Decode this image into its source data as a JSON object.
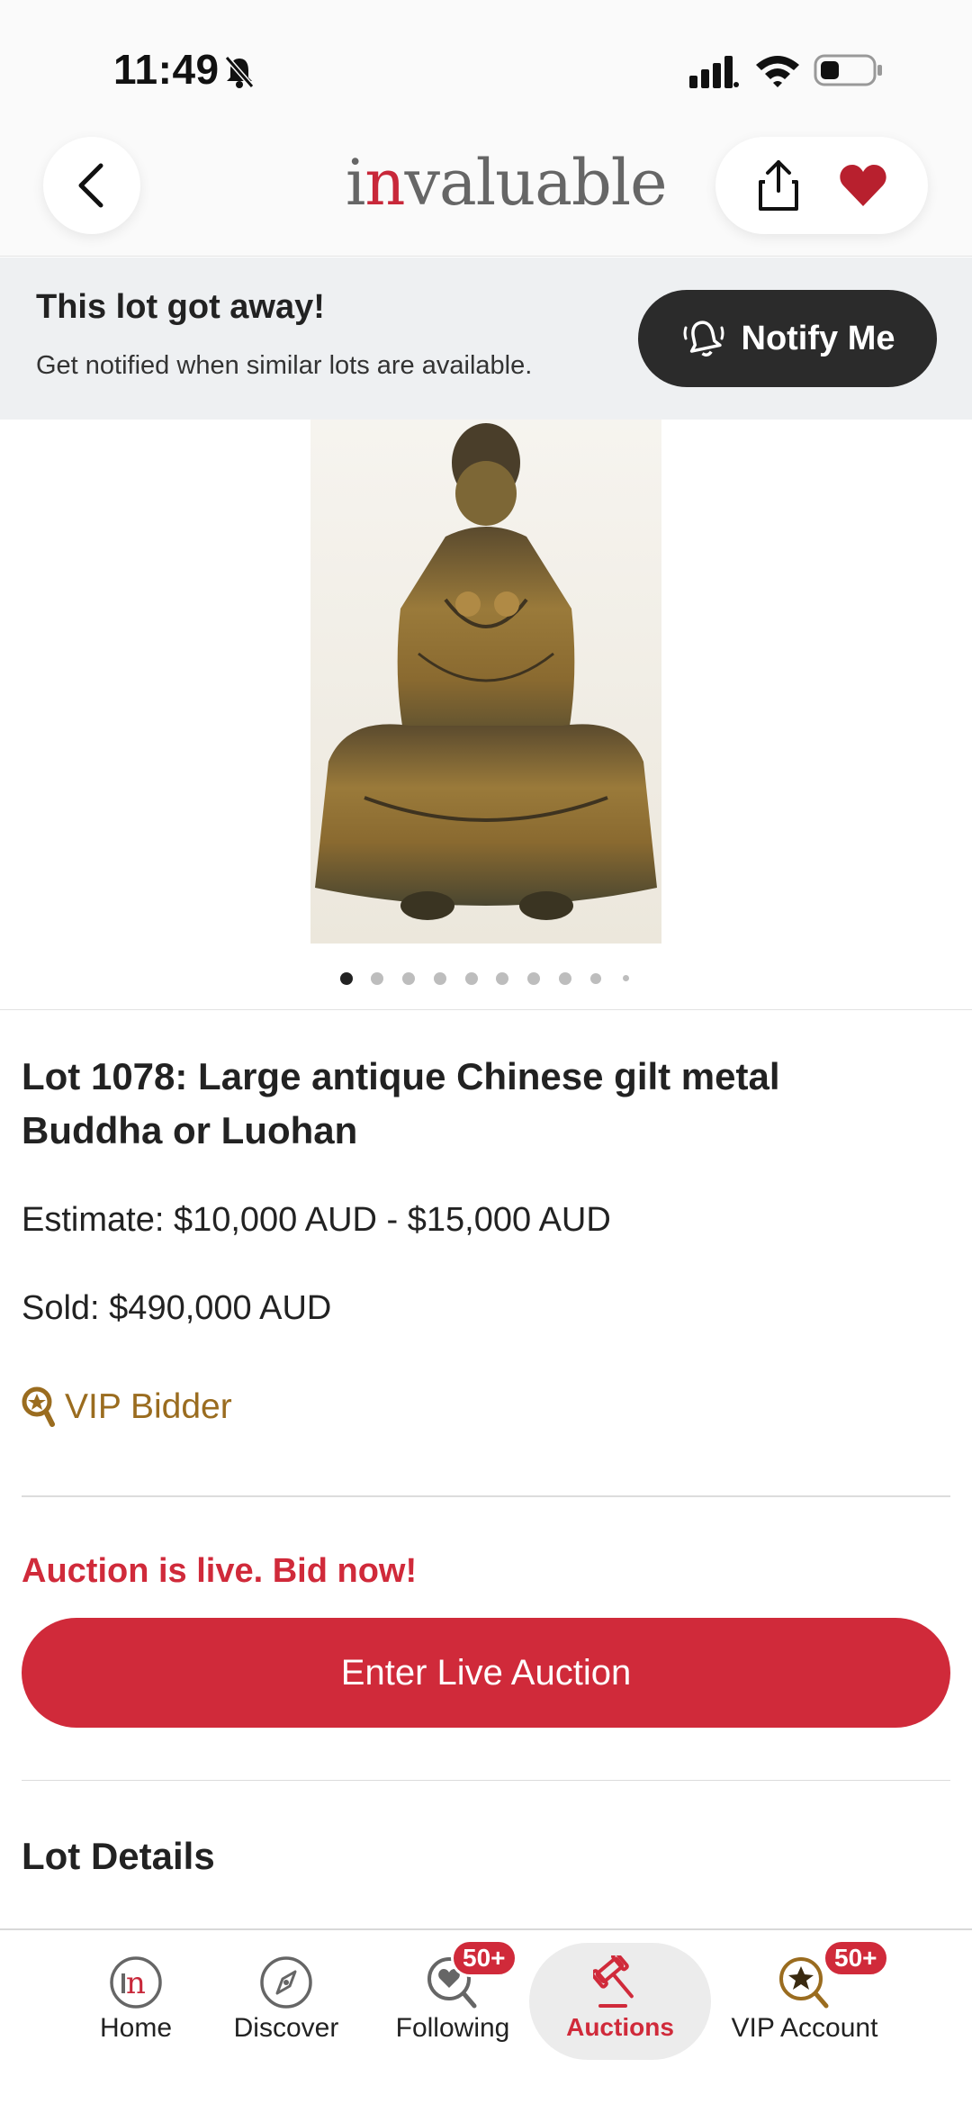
{
  "status_bar": {
    "time": "11:49"
  },
  "header": {
    "logo_first": "i",
    "logo_highlight": "n",
    "logo_rest": "valuable"
  },
  "banner": {
    "title": "This lot got away!",
    "subtitle": "Get notified when similar lots are available.",
    "notify_label": "Notify Me"
  },
  "carousel": {
    "total": 10,
    "active": 0
  },
  "lot": {
    "title": "Lot 1078: Large antique Chinese gilt metal Buddha or Luohan",
    "estimate": "Estimate: $10,000 AUD - $15,000 AUD",
    "sold": "Sold: $490,000 AUD",
    "vip": "VIP Bidder"
  },
  "auction": {
    "live_text": "Auction is live. Bid now!",
    "enter_label": "Enter Live Auction"
  },
  "section": {
    "lot_details": "Lot Details"
  },
  "tabs": [
    {
      "label": "Home",
      "icon": "home-logo-icon"
    },
    {
      "label": "Discover",
      "icon": "compass-icon"
    },
    {
      "label": "Following",
      "icon": "heart-search-icon",
      "badge": "50+"
    },
    {
      "label": "Auctions",
      "icon": "gavel-icon",
      "active": true
    },
    {
      "label": "VIP Account",
      "icon": "vip-search-icon",
      "badge": "50+"
    }
  ],
  "colors": {
    "brand_red": "#d02a3a",
    "vip_gold": "#9a6c1f",
    "dark_button": "#2b2b2b"
  }
}
